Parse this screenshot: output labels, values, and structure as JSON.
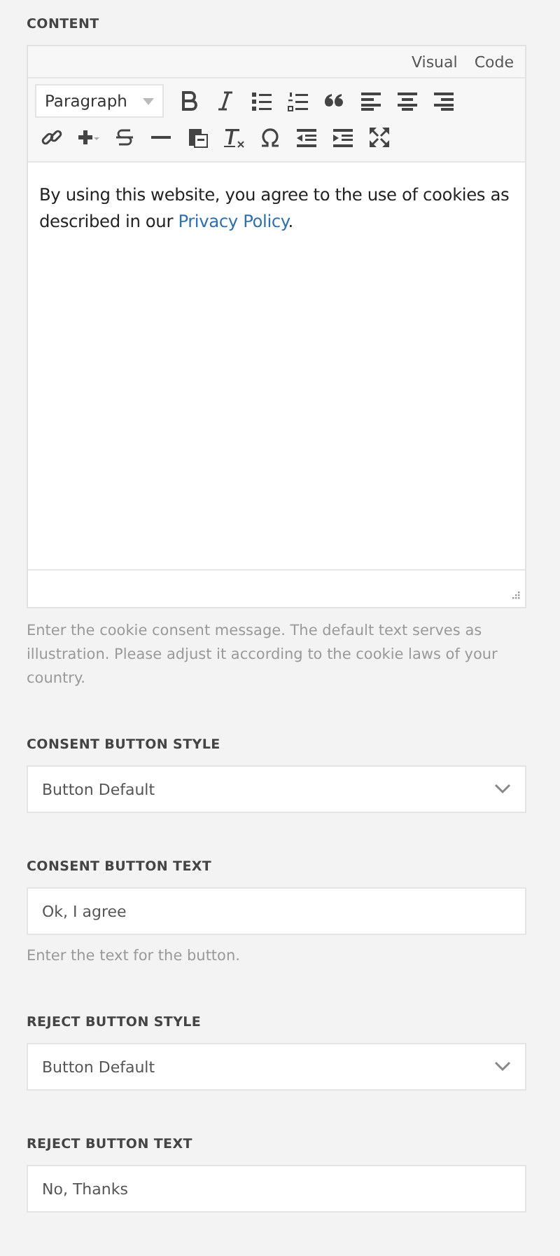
{
  "content": {
    "label": "CONTENT",
    "editor": {
      "tabs": [
        "Visual",
        "Code"
      ],
      "format": "Paragraph",
      "text": "By using this website, you agree to the use of cookies as described in our ",
      "link": "Privacy Policy",
      "after_link": "."
    },
    "help": "Enter the cookie consent message. The default text serves as illustration. Please adjust it according to the cookie laws of your country."
  },
  "fields": [
    {
      "kind": "select",
      "label": "CONSENT BUTTON STYLE",
      "value": "Button Default"
    },
    {
      "kind": "text",
      "label": "CONSENT BUTTON TEXT",
      "value": "Ok, I agree",
      "help": "Enter the text for the button."
    },
    {
      "kind": "select",
      "label": "REJECT BUTTON STYLE",
      "value": "Button Default"
    },
    {
      "kind": "text",
      "label": "REJECT BUTTON TEXT",
      "value": "No, Thanks"
    }
  ]
}
